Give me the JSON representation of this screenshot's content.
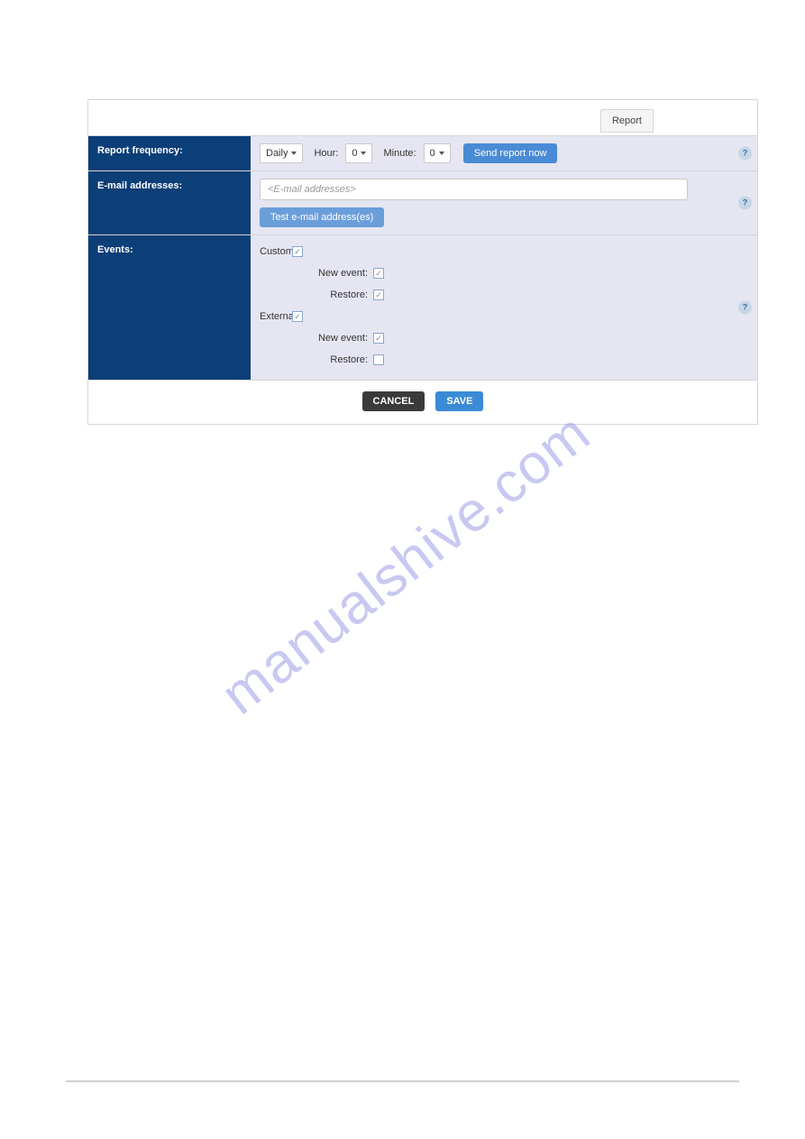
{
  "tab": {
    "label": "Report"
  },
  "rows": {
    "frequency": {
      "label": "Report frequency:",
      "daily": "Daily",
      "hour_label": "Hour:",
      "hour_value": "0",
      "minute_label": "Minute:",
      "minute_value": "0",
      "send_now": "Send report now"
    },
    "email": {
      "label": "E-mail addresses:",
      "placeholder": "<E-mail addresses>",
      "test_button": "Test e-mail address(es)"
    },
    "events": {
      "label": "Events:",
      "custom": "Custom:",
      "new_event": "New event:",
      "restore": "Restore:",
      "external": "External:"
    }
  },
  "footer": {
    "cancel": "CANCEL",
    "save": "SAVE"
  },
  "checkboxes": {
    "custom": true,
    "custom_new_event": true,
    "custom_restore": true,
    "external": true,
    "external_new_event": true,
    "external_restore": false
  },
  "watermark": "manualshive.com",
  "help_glyph": "?"
}
